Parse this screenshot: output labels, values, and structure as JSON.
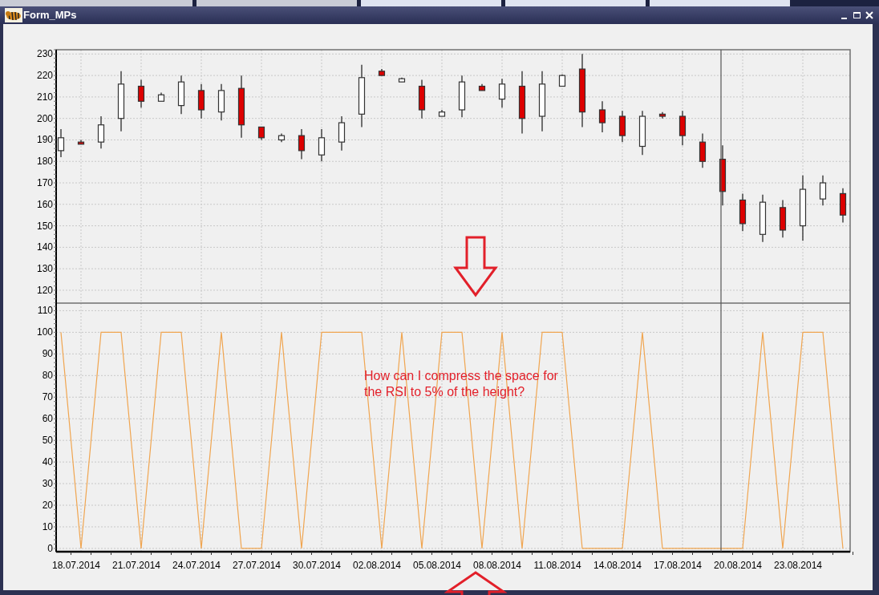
{
  "window": {
    "title": "Form_MPs"
  },
  "background_tabs": [
    {
      "kind": "tab"
    },
    {
      "kind": "tab"
    },
    {
      "kind": "tab"
    },
    {
      "kind": "tab"
    },
    {
      "kind": "tab"
    }
  ],
  "price_chart": {
    "chart_data": {
      "type": "candlestick",
      "grid": true,
      "categories": [
        null,
        null,
        null,
        null,
        null,
        null,
        null,
        null,
        null,
        null,
        null,
        null,
        null,
        null,
        null,
        null,
        null,
        null,
        null,
        null,
        null,
        null,
        null,
        null,
        null,
        null,
        null,
        null,
        null,
        null,
        null,
        null,
        null,
        null,
        null,
        null,
        null,
        null,
        null,
        null
      ],
      "ylim": [
        114,
        232
      ],
      "yticks": [
        120,
        130,
        140,
        150,
        160,
        170,
        180,
        190,
        200,
        210,
        220,
        230
      ],
      "ohlc": [
        [
          185,
          195,
          182,
          191
        ],
        [
          189,
          190,
          188,
          188
        ],
        [
          189,
          201,
          186,
          197
        ],
        [
          200,
          222,
          194,
          216
        ],
        [
          215,
          218,
          205,
          208
        ],
        [
          208,
          212,
          208,
          211
        ],
        [
          206,
          220,
          202,
          217
        ],
        [
          213,
          216,
          200,
          204
        ],
        [
          203,
          216,
          199,
          213
        ],
        [
          214,
          220,
          191,
          197
        ],
        [
          196,
          196,
          190,
          191
        ],
        [
          190,
          193,
          189,
          192
        ],
        [
          192,
          195,
          181,
          185
        ],
        [
          183,
          195,
          180,
          191
        ],
        [
          189,
          201,
          185,
          198
        ],
        [
          202,
          225,
          196,
          219
        ],
        [
          222,
          223,
          220,
          220
        ],
        [
          217,
          219,
          217,
          218.5
        ],
        [
          215,
          218,
          200,
          204
        ],
        [
          201,
          204,
          201,
          203
        ],
        [
          204,
          220,
          200.5,
          217
        ],
        [
          215,
          216,
          213,
          213
        ],
        [
          209,
          218.5,
          205,
          216
        ],
        [
          215,
          222,
          193,
          200
        ],
        [
          201,
          222,
          194,
          216
        ],
        [
          215,
          220.5,
          215,
          220
        ],
        [
          223,
          230,
          196,
          203
        ],
        [
          204,
          208,
          193.5,
          198
        ],
        [
          201,
          203.5,
          189,
          192
        ],
        [
          187,
          203.5,
          183,
          201
        ],
        [
          202,
          203,
          200,
          201
        ],
        [
          201,
          203.5,
          187.5,
          192
        ],
        [
          189,
          193,
          177,
          180
        ],
        [
          181,
          187.5,
          159.5,
          166
        ],
        [
          162,
          165,
          147.5,
          151
        ],
        [
          146,
          164.5,
          142.5,
          161
        ],
        [
          158.5,
          162,
          144.5,
          148
        ],
        [
          150,
          173.5,
          143,
          167
        ],
        [
          162.5,
          173.5,
          159.5,
          170
        ],
        [
          165,
          167.5,
          151.5,
          155
        ]
      ]
    }
  },
  "rsi_chart": {
    "chart_data": {
      "type": "line",
      "grid": true,
      "categories": [
        null,
        "18.07.2014",
        null,
        null,
        "21.07.2014",
        null,
        null,
        "24.07.2014",
        null,
        null,
        "27.07.2014",
        null,
        null,
        "30.07.2014",
        null,
        null,
        "02.08.2014",
        null,
        null,
        "05.08.2014",
        null,
        null,
        "08.08.2014",
        null,
        null,
        "11.08.2014",
        null,
        null,
        "14.08.2014",
        null,
        null,
        "17.08.2014",
        null,
        null,
        "20.08.2014",
        null,
        null,
        "23.08.2014",
        null,
        null
      ],
      "ylim": [
        -1.5,
        113.5
      ],
      "yticks": [
        0,
        10,
        20,
        30,
        40,
        50,
        60,
        70,
        80,
        90,
        100,
        110
      ],
      "series": [
        {
          "color": "#f0a550",
          "values": [
            100,
            0,
            100,
            100,
            0,
            100,
            100,
            0,
            100,
            0,
            0,
            100,
            0,
            100,
            100,
            100,
            0,
            100,
            0,
            100,
            100,
            0,
            100,
            0,
            100,
            100,
            0,
            0,
            0,
            100,
            0,
            0,
            0,
            0,
            0,
            100,
            0,
            100,
            100,
            0
          ]
        }
      ]
    },
    "note": [
      "How can I compress the space for",
      "the RSI to 5% of the height?"
    ]
  }
}
